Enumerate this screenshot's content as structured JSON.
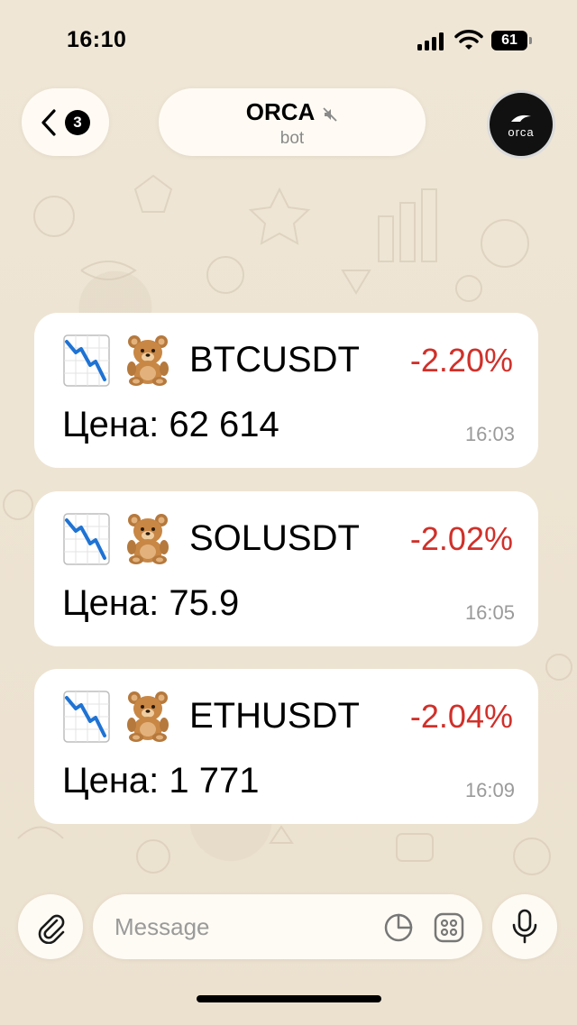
{
  "status_bar": {
    "time": "16:10",
    "battery_level": "61",
    "icons": [
      "signal-icon",
      "wifi-icon",
      "battery-icon"
    ]
  },
  "header": {
    "back_badge_count": "3",
    "title": "ORCA",
    "subtitle": "bot",
    "muted": true,
    "avatar_text": "orca",
    "icons": [
      "back-chevron-icon",
      "mute-icon",
      "orca-logo-icon"
    ]
  },
  "messages": [
    {
      "symbol": "BTCUSDT",
      "change": "-2.20%",
      "price": "Цена: 62 614",
      "time": "16:03"
    },
    {
      "symbol": "SOLUSDT",
      "change": "-2.02%",
      "price": "Цена: 75.9",
      "time": "16:05"
    },
    {
      "symbol": "ETHUSDT",
      "change": "-2.04%",
      "price": "Цена: 1 771",
      "time": "16:09"
    }
  ],
  "message_icons": [
    "chart-decreasing-icon",
    "teddy-bear-icon"
  ],
  "composer": {
    "placeholder": "Message",
    "icons": [
      "paperclip-icon",
      "sticker-icon",
      "bot-commands-icon",
      "microphone-icon"
    ]
  },
  "colors": {
    "negative_change": "#d0302a",
    "background": "#efe6d8",
    "bubble": "#ffffff",
    "timestamp": "#9a9a9a"
  }
}
